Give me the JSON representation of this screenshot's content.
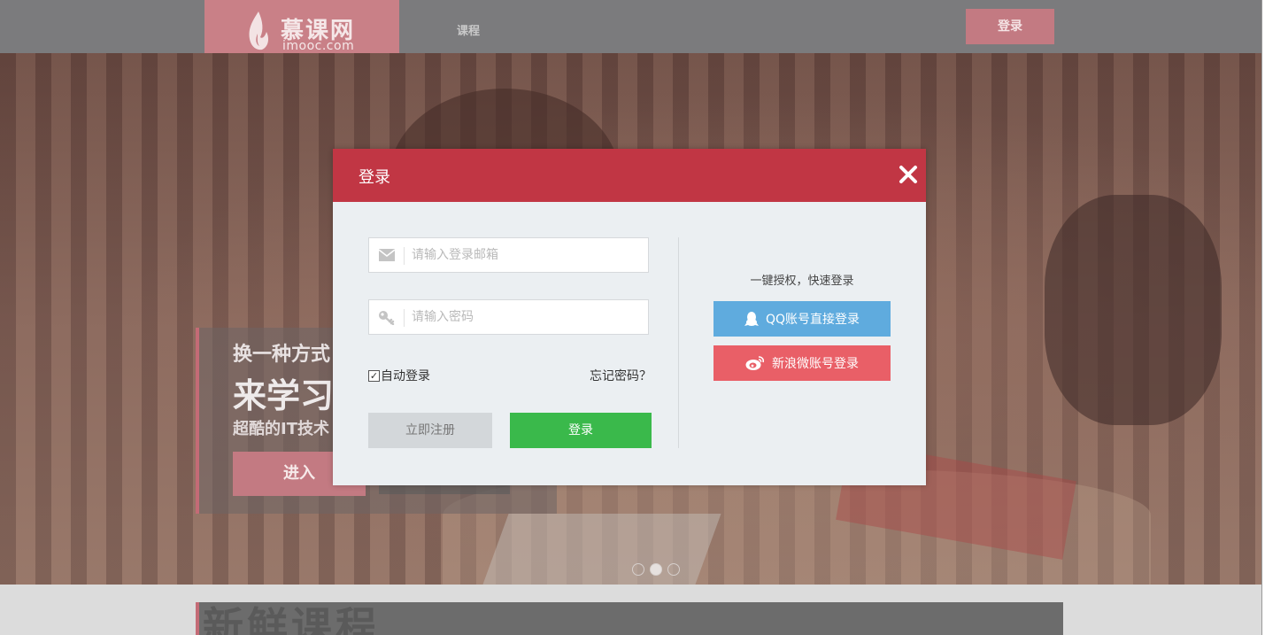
{
  "header": {
    "logo_name": "慕课网",
    "logo_domain": "imooc.com",
    "nav_courses": "课程",
    "login_button": "登录"
  },
  "hero": {
    "line1": "换一种方式",
    "line2": "来学习",
    "line3": "超酷的IT技术",
    "enter_button": "进入",
    "carousel_active_index": 2,
    "carousel_count": 3
  },
  "bottom": {
    "section_title": "新鲜课程"
  },
  "modal": {
    "title": "登录",
    "email_placeholder": "请输入登录邮箱",
    "password_placeholder": "请输入密码",
    "auto_login_label": "自动登录",
    "auto_login_checked": true,
    "forgot_password": "忘记密码？",
    "register_button": "立即注册",
    "login_button": "登录",
    "oneclick_text": "一键授权，快速登录",
    "qq_button": "QQ账号直接登录",
    "weibo_button": "新浪微账号登录"
  },
  "colors": {
    "modal_header": "#c13644",
    "login_green": "#3ab94b",
    "qq_blue": "#5fabde",
    "weibo_red": "#e95f67",
    "brand_pink": "#c98087"
  },
  "icons": {
    "email_field": "envelope-icon",
    "password_field": "key-icon",
    "close": "close-icon",
    "qq": "qq-penguin-icon",
    "weibo": "weibo-icon",
    "logo": "flame-icon"
  }
}
